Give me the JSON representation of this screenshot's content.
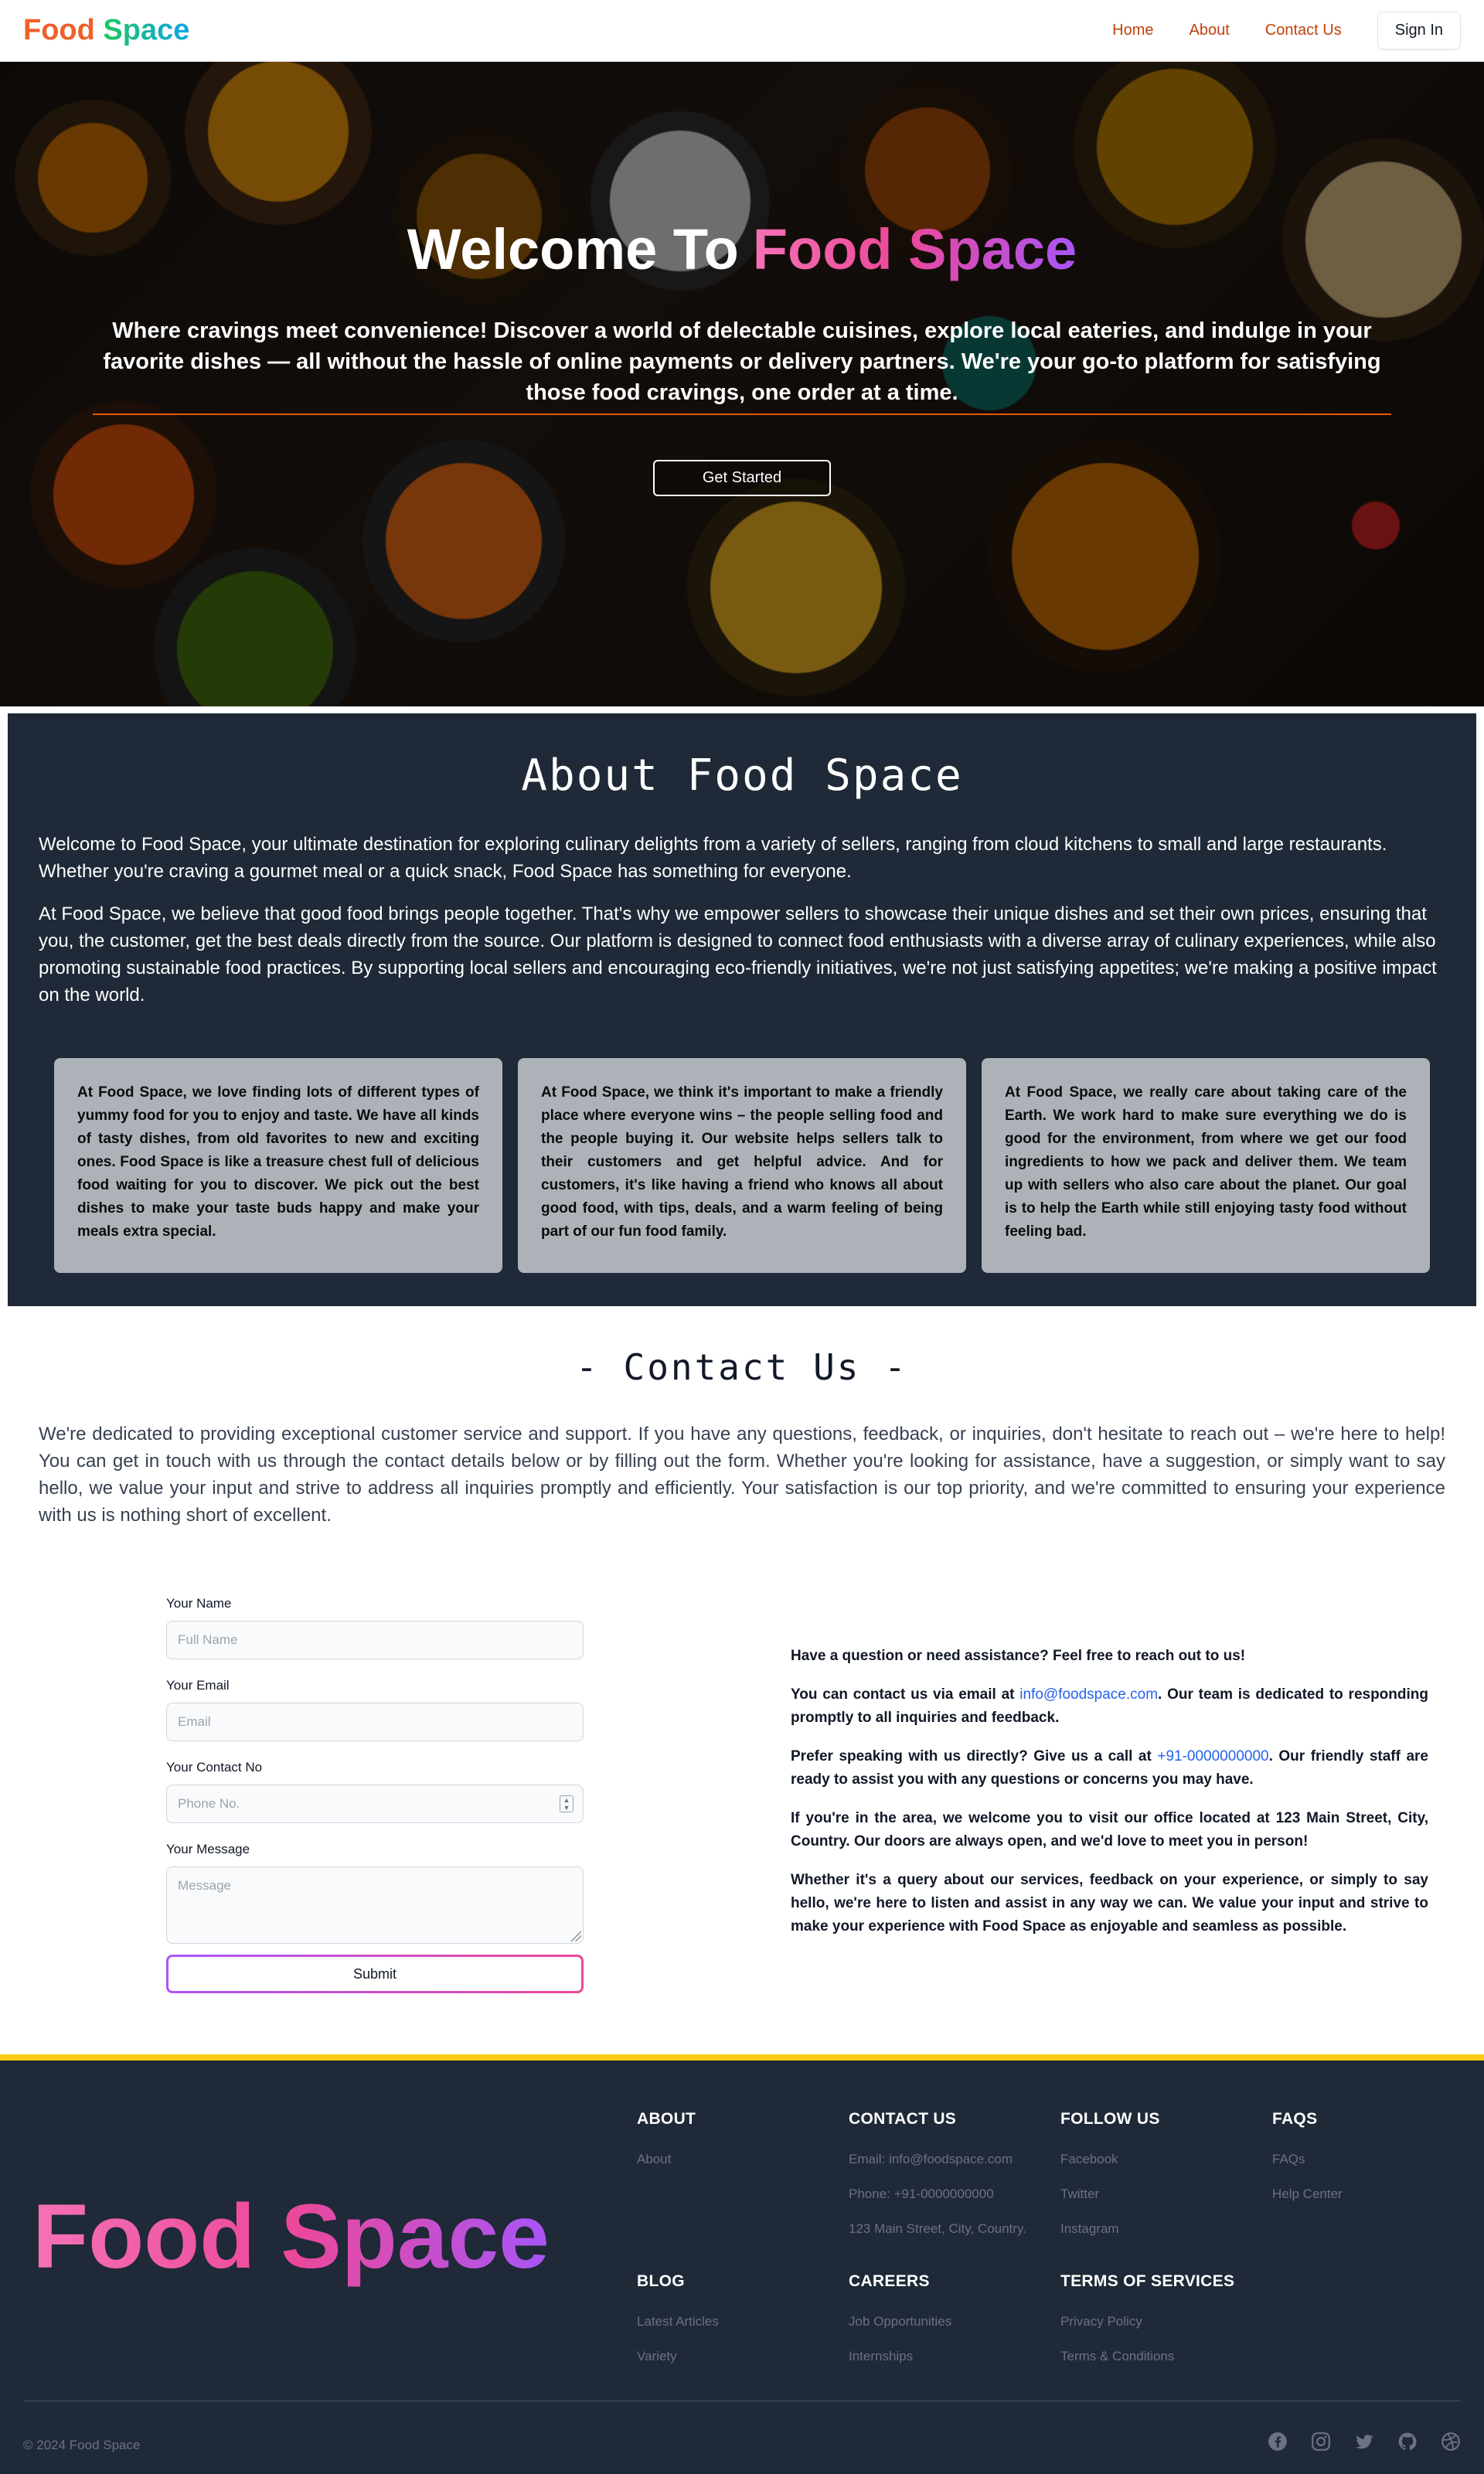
{
  "nav": {
    "logo_word1": "Food",
    "logo_word2": "Space",
    "links": [
      "Home",
      "About",
      "Contact Us"
    ],
    "sign_in": "Sign In"
  },
  "hero": {
    "title_prefix": "Welcome To",
    "title_brand": "Food Space",
    "subtitle": "Where cravings meet convenience! Discover a world of delectable cuisines, explore local eateries, and indulge in your favorite dishes — all without the hassle of online payments or delivery partners. We're your go-to platform for satisfying those food cravings, one order at a time.",
    "cta": "Get Started"
  },
  "about": {
    "title": "About Food Space",
    "p1": "Welcome to Food Space, your ultimate destination for exploring culinary delights from a variety of sellers, ranging from cloud kitchens to small and large restaurants. Whether you're craving a gourmet meal or a quick snack, Food Space has something for everyone.",
    "p2": "At Food Space, we believe that good food brings people together. That's why we empower sellers to showcase their unique dishes and set their own prices, ensuring that you, the customer, get the best deals directly from the source. Our platform is designed to connect food enthusiasts with a diverse array of culinary experiences, while also promoting sustainable food practices. By supporting local sellers and encouraging eco-friendly initiatives, we're not just satisfying appetites; we're making a positive impact on the world.",
    "cards": [
      "At Food Space, we love finding lots of different types of yummy food for you to enjoy and taste. We have all kinds of tasty dishes, from old favorites to new and exciting ones. Food Space is like a treasure chest full of delicious food waiting for you to discover. We pick out the best dishes to make your taste buds happy and make your meals extra special.",
      "At Food Space, we think it's important to make a friendly place where everyone wins – the people selling food and the people buying it. Our website helps sellers talk to their customers and get helpful advice. And for customers, it's like having a friend who knows all about good food, with tips, deals, and a warm feeling of being part of our fun food family.",
      "At Food Space, we really care about taking care of the Earth. We work hard to make sure everything we do is good for the environment, from where we get our food ingredients to how we pack and deliver them. We team up with sellers who also care about the planet. Our goal is to help the Earth while still enjoying tasty food without feeling bad."
    ]
  },
  "contact": {
    "title": "- Contact Us -",
    "intro": "We're dedicated to providing exceptional customer service and support. If you have any questions, feedback, or inquiries, don't hesitate to reach out – we're here to help! You can get in touch with us through the contact details below or by filling out the form. Whether you're looking for assistance, have a suggestion, or simply want to say hello, we value your input and strive to address all inquiries promptly and efficiently. Your satisfaction is our top priority, and we're committed to ensuring your experience with us is nothing short of excellent.",
    "form": {
      "name_label": "Your Name",
      "name_placeholder": "Full Name",
      "email_label": "Your Email",
      "email_placeholder": "Email",
      "phone_label": "Your Contact No",
      "phone_placeholder": "Phone No.",
      "message_label": "Your Message",
      "message_placeholder": "Message",
      "submit": "Submit"
    },
    "info": {
      "p1": "Have a question or need assistance? Feel free to reach out to us!",
      "p2_before": "You can contact us via email at ",
      "email": "info@foodspace.com",
      "p2_after": ". Our team is dedicated to responding promptly to all inquiries and feedback.",
      "p3_before": "Prefer speaking with us directly? Give us a call at ",
      "phone": "+91-0000000000",
      "p3_after": ". Our friendly staff are ready to assist you with any questions or concerns you may have.",
      "p4": "If you're in the area, we welcome you to visit our office located at 123 Main Street, City, Country. Our doors are always open, and we'd love to meet you in person!",
      "p5": "Whether it's a query about our services, feedback on your experience, or simply to say hello, we're here to listen and assist in any way we can. We value your input and strive to make your experience with Food Space as enjoyable and seamless as possible."
    }
  },
  "footer": {
    "logo": "Food Space",
    "columns": [
      {
        "heading": "ABOUT",
        "items": [
          "About"
        ]
      },
      {
        "heading": "CONTACT US",
        "items": [
          "Email: info@foodspace.com",
          "Phone: +91-0000000000",
          "123 Main Street, City, Country."
        ]
      },
      {
        "heading": "FOLLOW US",
        "items": [
          "Facebook",
          "Twitter",
          "Instagram"
        ]
      },
      {
        "heading": "FAQS",
        "items": [
          "FAQs",
          "Help Center"
        ]
      },
      {
        "heading": "BLOG",
        "items": [
          "Latest Articles",
          "Variety"
        ]
      },
      {
        "heading": "CAREERS",
        "items": [
          "Job Opportunities",
          "Internships"
        ]
      },
      {
        "heading": "TERMS OF SERVICES",
        "items": [
          "Privacy Policy",
          "Terms & Conditions"
        ]
      }
    ],
    "copyright": "© 2024 Food Space",
    "social_icons": [
      "facebook-icon",
      "instagram-icon",
      "twitter-icon",
      "github-icon",
      "dribbble-icon"
    ]
  },
  "colors": {
    "accent_orange": "#c2410c",
    "brand_pink": "#ec4899",
    "brand_purple": "#a855f7",
    "dark_bg": "#1f2937",
    "footer_border": "#facc15",
    "link_blue": "#2563eb"
  }
}
